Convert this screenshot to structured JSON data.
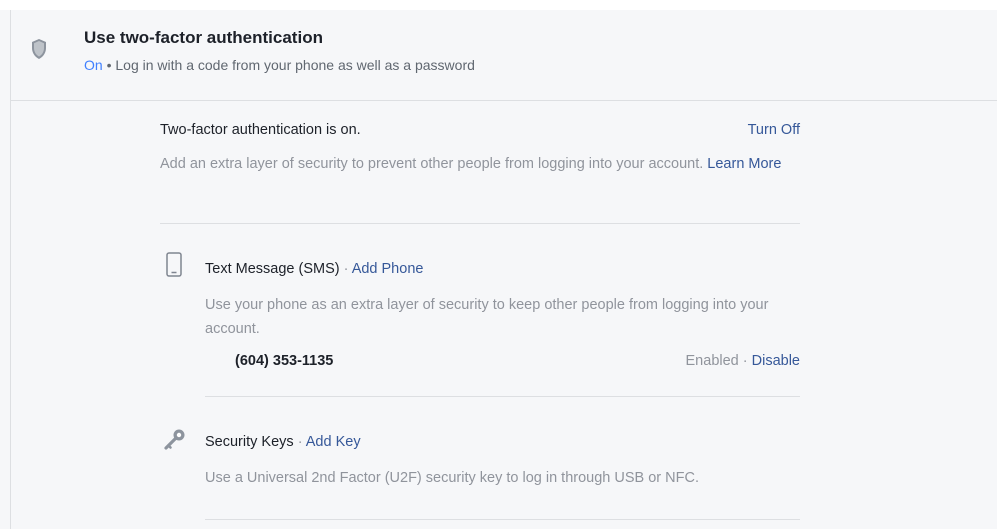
{
  "header": {
    "title": "Use two-factor authentication",
    "status": "On",
    "separator": "•",
    "subtitle": "Log in with a code from your phone as well as a password"
  },
  "summary": {
    "status_text": "Two-factor authentication is on.",
    "turn_off_label": "Turn Off",
    "description": "Add an extra layer of security to prevent other people from logging into your account.",
    "learn_more_label": "Learn More"
  },
  "methods": {
    "sms": {
      "title": "Text Message (SMS)",
      "separator": "·",
      "action_label": "Add Phone",
      "description": "Use your phone as an extra layer of security to keep other people from logging into your account.",
      "phone": {
        "number": "(604) 353-1135",
        "state": "Enabled",
        "separator": "·",
        "action_label": "Disable"
      }
    },
    "security_keys": {
      "title": "Security Keys",
      "separator": "·",
      "action_label": "Add Key",
      "description": "Use a Universal 2nd Factor (U2F) security key to log in through USB or NFC."
    }
  },
  "colors": {
    "background": "#f6f7f9",
    "link": "#365899",
    "status_on": "#4080ff",
    "text_primary": "#1d2129",
    "text_secondary": "#90949c",
    "divider": "#dddfe2"
  }
}
